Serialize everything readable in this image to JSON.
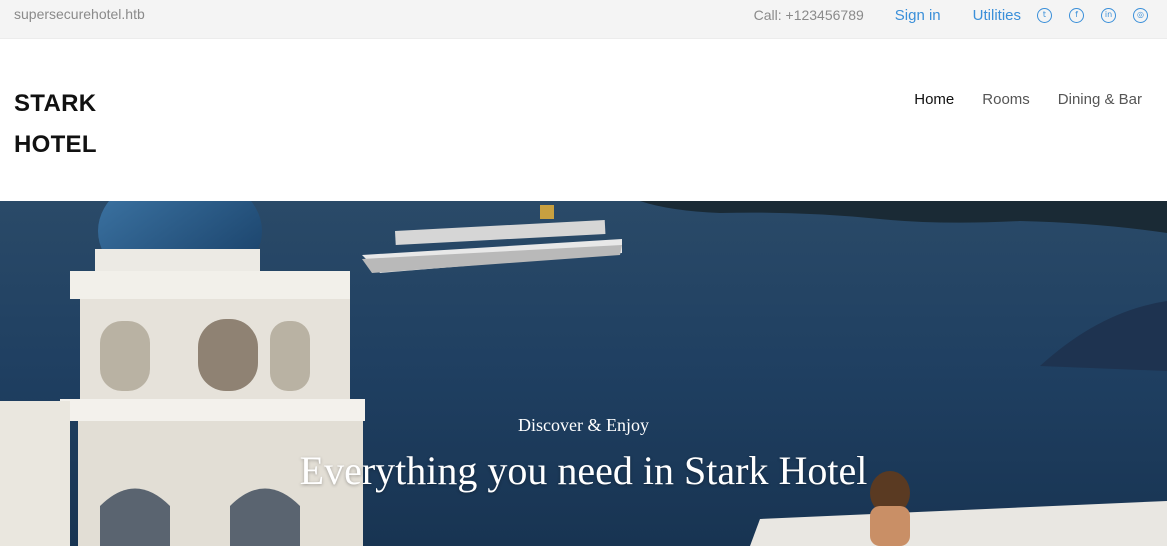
{
  "topbar": {
    "domain": "supersecurehotel.htb",
    "call": "Call: +123456789",
    "signin": "Sign in",
    "utilities": "Utilities",
    "social": [
      {
        "icon": "twitter-icon",
        "glyph": "t"
      },
      {
        "icon": "facebook-icon",
        "glyph": "f"
      },
      {
        "icon": "linkedin-icon",
        "glyph": "in"
      },
      {
        "icon": "dribbble-icon",
        "glyph": "◎"
      }
    ]
  },
  "header": {
    "logo_line1": "STARK",
    "logo_line2": "HOTEL",
    "nav": [
      {
        "label": "Home",
        "active": true
      },
      {
        "label": "Rooms",
        "active": false
      },
      {
        "label": "Dining & Bar",
        "active": false
      }
    ]
  },
  "hero": {
    "subtitle": "Discover & Enjoy",
    "title": "Everything you need in Stark Hotel"
  },
  "colors": {
    "accent": "#3a8fd9",
    "topbar_bg": "#f4f4f4",
    "sea": "#1d3a5a"
  }
}
